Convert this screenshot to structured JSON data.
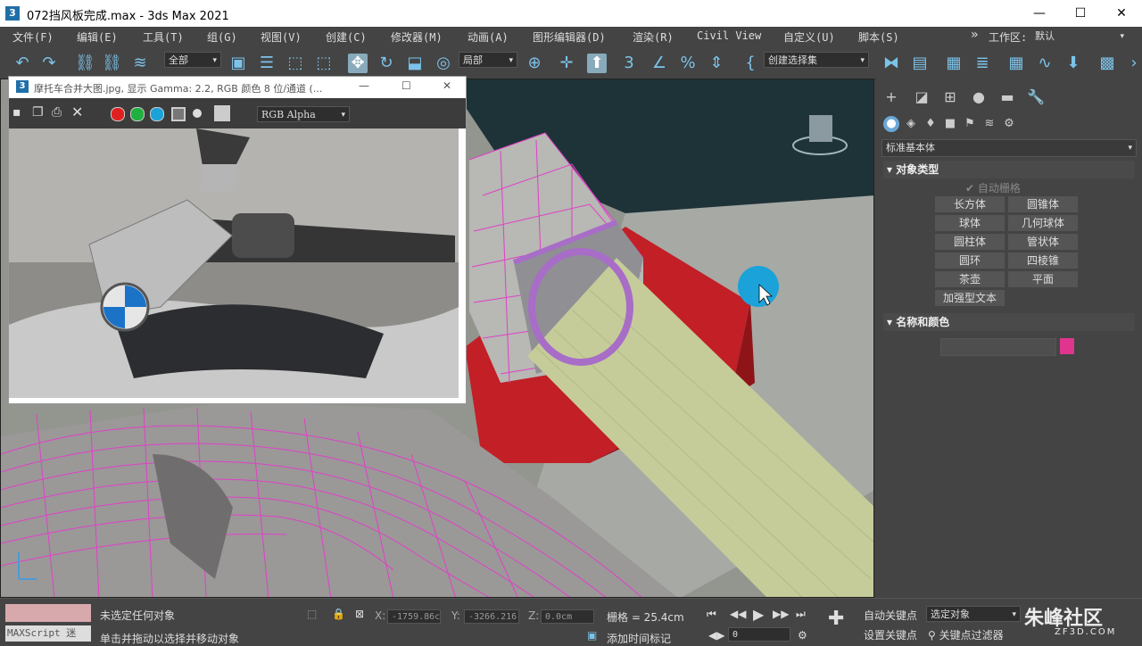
{
  "app": {
    "title": "072挡风板完成.max - 3ds Max 2021",
    "icon_label": "3",
    "window_controls": [
      "—",
      "☐",
      "✕"
    ]
  },
  "menu": {
    "items": [
      "文件(F)",
      "编辑(E)",
      "工具(T)",
      "组(G)",
      "视图(V)",
      "创建(C)",
      "修改器(M)",
      "动画(A)",
      "图形编辑器(D)",
      "渲染(R)",
      "Civil View",
      "自定义(U)",
      "脚本(S)"
    ],
    "overflow": "»",
    "workspace_label": "工作区:",
    "workspace_value": "默认"
  },
  "toolbar": {
    "selection_filter": "全部",
    "coord_system": "局部",
    "named_selection": "创建选择集"
  },
  "image_window": {
    "title": "摩托车合并大图.jpg, 显示 Gamma: 2.2, RGB 颜色 8 位/通道 (...",
    "icon_label": "3",
    "channel": "RGB Alpha",
    "controls": [
      "—",
      "☐",
      "✕"
    ]
  },
  "command_panel": {
    "category": "标准基本体",
    "object_type_header": "对象类型",
    "autogrid_label": "自动栅格",
    "buttons": [
      "长方体",
      "圆锥体",
      "球体",
      "几何球体",
      "圆柱体",
      "管状体",
      "圆环",
      "四棱锥",
      "茶壶",
      "平面",
      "加强型文本"
    ],
    "name_color_header": "名称和颜色",
    "object_color": "#e0358f"
  },
  "status": {
    "maxscript_label": "MAXScript 迷",
    "status_line1": "未选定任何对象",
    "status_line2": "单击并拖动以选择并移动对象",
    "x_label": "X:",
    "x_value": "-1759.86c",
    "y_label": "Y:",
    "y_value": "-3266.216",
    "z_label": "Z:",
    "z_value": "0.0cm",
    "grid_label": "栅格 = 25.4cm",
    "add_time_tag": "添加时间标记",
    "frame_value": "0",
    "autokey": "自动关键点",
    "setkey": "设置关键点",
    "key_filter_select": "选定对象",
    "key_filters": "关键点过滤器"
  },
  "watermark": {
    "brand": "朱峰社区",
    "site": "ZF3D.COM"
  },
  "colors": {
    "accent": "#1f9bd7",
    "cursor_circle": "#1ba3d9",
    "wire": "#e040c8",
    "red_box": "#c21f27",
    "cylinder": "#c5cc9a"
  }
}
